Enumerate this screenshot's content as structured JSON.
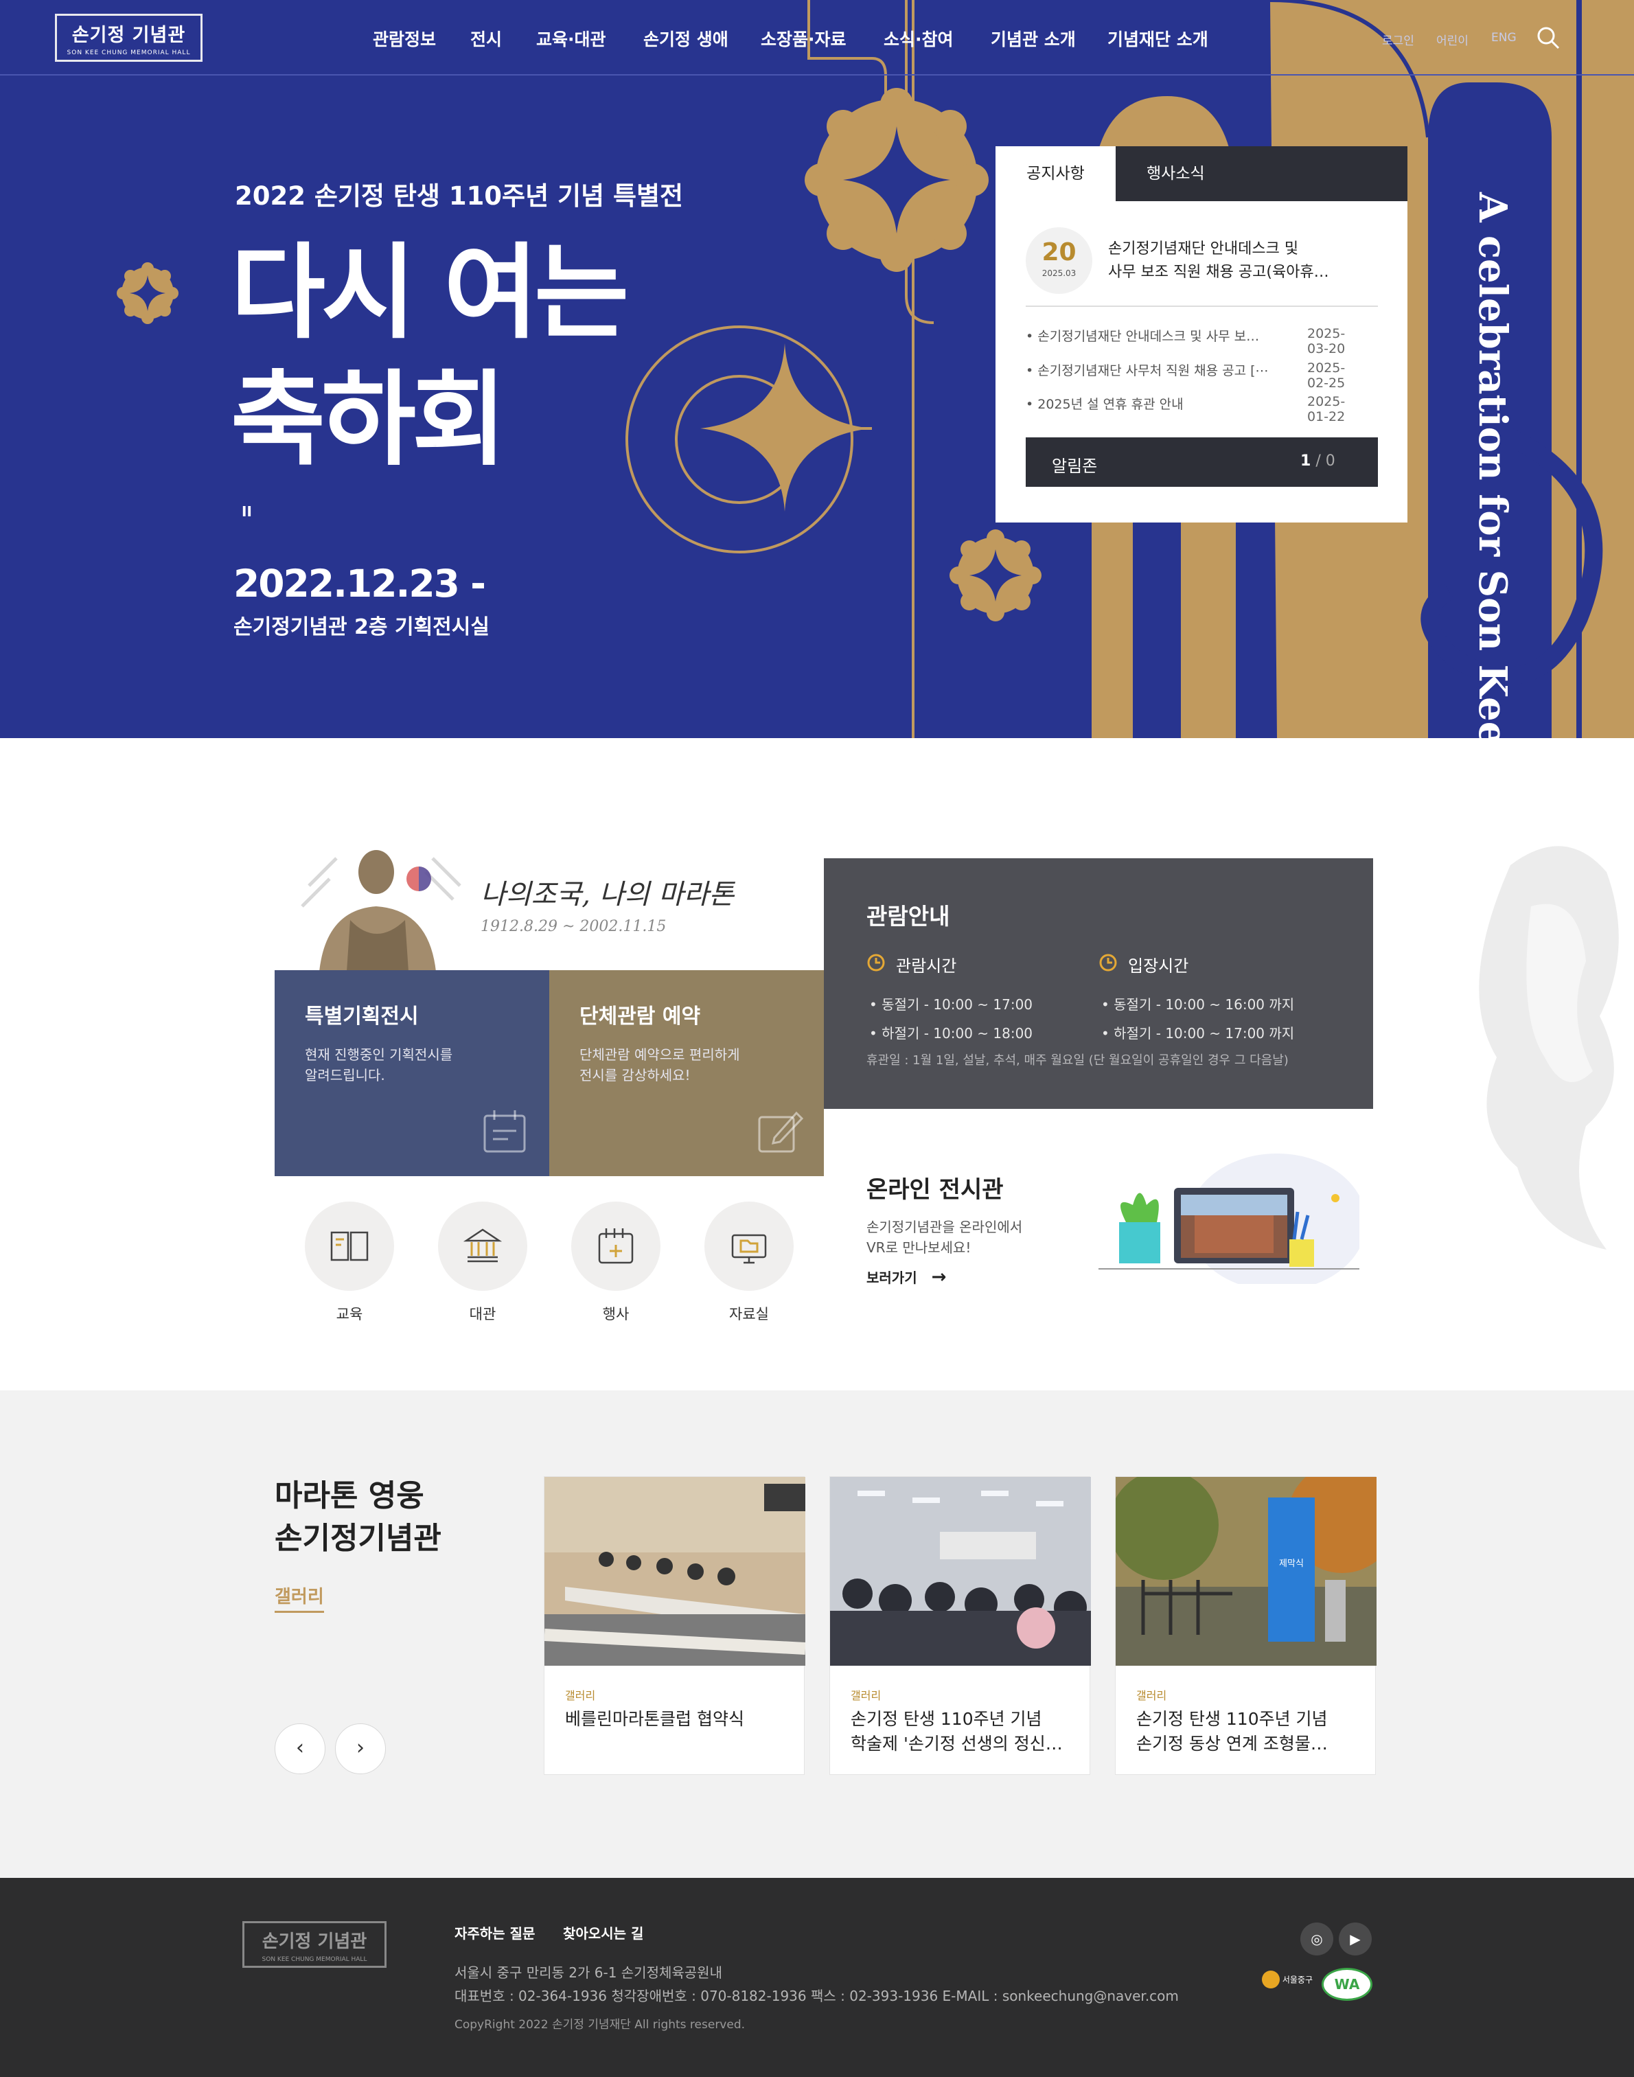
{
  "header": {
    "logo_text": "손기정 기념관",
    "logo_sub": "SON KEE CHUNG MEMORIAL HALL",
    "nav": [
      "관람정보",
      "전시",
      "교육·대관",
      "손기정 생애",
      "소장품·자료",
      "소식·참여",
      "기념관 소개",
      "기념재단 소개"
    ],
    "util": [
      "로그인",
      "어린이",
      "ENG"
    ]
  },
  "hero": {
    "subtitle": "2022 손기정 탄생 110주년 기념 특별전",
    "title_line1": "다시 여는",
    "title_line2": "축하회",
    "pause": "II",
    "date": "2022.12.23 -",
    "place": "손기정기념관 2층 기획전시실",
    "vertical_text": "A celebration for Son Kee Chung"
  },
  "notice": {
    "tabs": [
      "공지사항",
      "행사소식"
    ],
    "featured": {
      "day": "20",
      "month": "2025.03",
      "title_line1": "손기정기념재단 안내데스크 및",
      "title_line2": "사무 보조 직원 채용 공고(육아휴…"
    },
    "items": [
      {
        "title": "손기정기념재단 안내데스크 및 사무 보…",
        "date": "2025-03-20"
      },
      {
        "title": "손기정기념재단 사무처 직원 채용 공고 [⋯",
        "date": "2025-02-25"
      },
      {
        "title": "2025년 설 연휴 휴관 안내",
        "date": "2025-01-22"
      }
    ],
    "alarm_label": "알림존",
    "page_current": "1",
    "page_sep": "/",
    "page_total": "0"
  },
  "intro": {
    "slogan": "나의조국, 나의 마라톤",
    "years": "1912.8.29 ~ 2002.11.15"
  },
  "cards": [
    {
      "title": "특별기획전시",
      "line1": "현재 진행중인 기획전시를",
      "line2": "알려드립니다."
    },
    {
      "title": "단체관람 예약",
      "line1": "단체관람 예약으로 편리하게",
      "line2": "전시를 감상하세요!"
    }
  ],
  "visit": {
    "title": "관람안내",
    "hours_title": "관람시간",
    "hours": [
      "동절기 - 10:00 ~ 17:00",
      "하절기 - 10:00 ~ 18:00"
    ],
    "entry_title": "입장시간",
    "entry": [
      "동절기 - 10:00 ~ 16:00 까지",
      "하절기 - 10:00 ~ 17:00 까지"
    ],
    "closed": "휴관일 : 1월 1일, 설날, 추석, 매주 월요일 (단 월요일이 공휴일인 경우 그 다음날)"
  },
  "online": {
    "title": "온라인 전시관",
    "line1": "손기정기념관을 온라인에서",
    "line2": "VR로 만나보세요!",
    "link": "보러가기"
  },
  "quick": [
    "교육",
    "대관",
    "행사",
    "자료실"
  ],
  "gallery": {
    "title_line1": "마라톤 영웅",
    "title_line2": "손기정기념관",
    "label": "갤러리",
    "items": [
      {
        "cat": "갤러리",
        "line1": "베를린마라톤클럽 협약식",
        "line2": ""
      },
      {
        "cat": "갤러리",
        "line1": "손기정 탄생 110주년 기념",
        "line2": "학술제 '손기정 선생의 정신…"
      },
      {
        "cat": "갤러리",
        "line1": "손기정 탄생 110주년 기념",
        "line2": "손기정 동상 연계 조형물…"
      }
    ],
    "banner_text": "손기정 동상 연계 조형물 제막식"
  },
  "footer": {
    "links": [
      "자주하는 질문",
      "찾아오시는 길"
    ],
    "address": "서울시 중구 만리동 2가 6-1 손기정체육공원내",
    "contact": "대표번호 : 02-364-1936   청각장애번호 : 070-8182-1936   팩스 : 02-393-1936   E-MAIL : sonkeechung@naver.com",
    "copyright": "CopyRight 2022 손기정 기념재단 All rights reserved.",
    "badge_jung": "서울중구",
    "badge_wa": "WA"
  },
  "colors": {
    "hero_bg": "#28348f",
    "gold": "#c19a5e",
    "card_blue": "#45527a",
    "card_brown": "#928160",
    "dark": "#2d2d2e"
  }
}
